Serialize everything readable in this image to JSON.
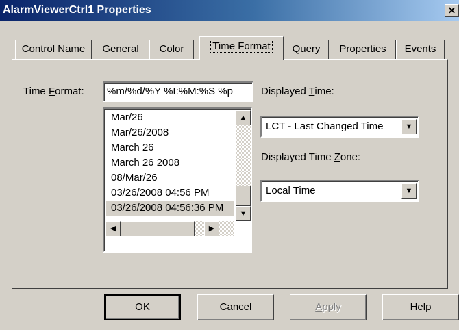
{
  "window": {
    "title": "AlarmViewerCtrl1 Properties",
    "close_glyph": "✕"
  },
  "tabs": [
    {
      "label": "Control Name"
    },
    {
      "label": "General"
    },
    {
      "label": "Color"
    },
    {
      "label": "Time Format",
      "active": true
    },
    {
      "label": "Query"
    },
    {
      "label": "Properties"
    },
    {
      "label": "Events"
    }
  ],
  "time_format": {
    "label_pre": "Time ",
    "label_accel": "F",
    "label_post": "ormat:",
    "value": "%m/%d/%Y %I:%M:%S %p",
    "list": [
      "Mar/26",
      "Mar/26/2008",
      "March 26",
      "March 26 2008",
      "08/Mar/26",
      "03/26/2008 04:56 PM",
      "03/26/2008 04:56:36 PM"
    ],
    "selected_index": 6
  },
  "displayed_time": {
    "label_pre": "Displayed ",
    "label_accel": "T",
    "label_post": "ime:",
    "value": "LCT - Last Changed Time"
  },
  "displayed_time_zone": {
    "label_pre": "Displayed Time ",
    "label_accel": "Z",
    "label_post": "one:",
    "value": "Local Time"
  },
  "buttons": {
    "ok": "OK",
    "cancel": "Cancel",
    "apply_accel": "A",
    "apply_rest": "pply",
    "help": "Help"
  },
  "icons": {
    "up": "▲",
    "down": "▼",
    "left": "◀",
    "right": "▶"
  }
}
